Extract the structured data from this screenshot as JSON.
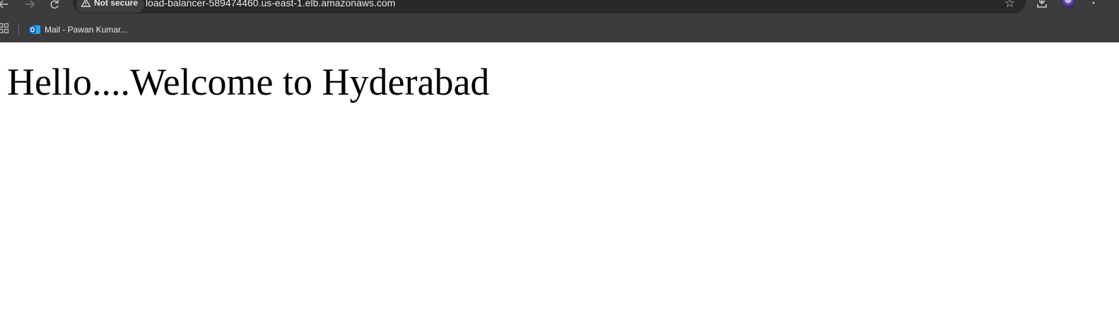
{
  "browser": {
    "nav": {
      "back_icon": "arrow-left-icon",
      "forward_icon": "arrow-right-icon",
      "reload_icon": "reload-icon"
    },
    "omnibox": {
      "security_label": "Not secure",
      "url": "load-balancer-589474460.us-east-1.elb.amazonaws.com"
    },
    "bookmarks": [
      {
        "label": "Mail - Pawan Kumar...",
        "icon": "outlook-icon"
      }
    ]
  },
  "page": {
    "heading": "Hello....Welcome to Hyderabad"
  },
  "colors": {
    "chrome_bg": "#3c3c3c",
    "omnibox_bg": "#282828",
    "page_bg": "#ffffff",
    "text": "#000000",
    "outlook_blue": "#0a64c8"
  }
}
